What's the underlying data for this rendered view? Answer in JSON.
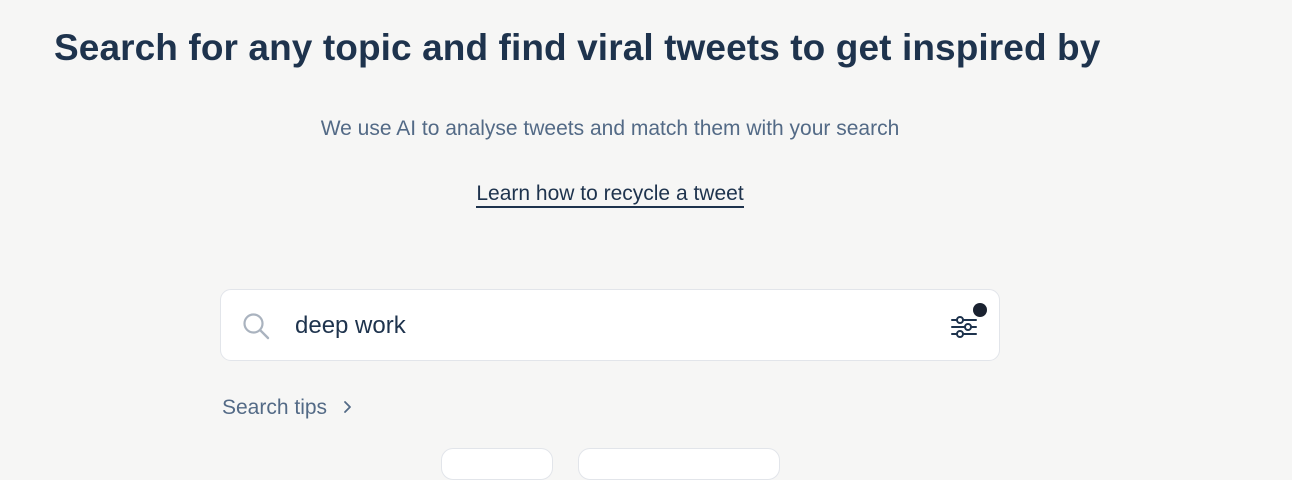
{
  "header": {
    "title": "Search for any topic and find viral tweets to get inspired by",
    "subtitle": "We use AI to analyse tweets and match them with your search",
    "learn_link": "Learn how to recycle a tweet"
  },
  "search": {
    "value": "deep work",
    "placeholder": "",
    "icon": "search-icon",
    "filter_icon": "sliders-icon"
  },
  "tips": {
    "label": "Search tips",
    "icon": "chevron-right-icon"
  },
  "colors": {
    "heading": "#1e334d",
    "muted": "#536a86",
    "background": "#f6f6f5",
    "badge": "#1a2230"
  }
}
